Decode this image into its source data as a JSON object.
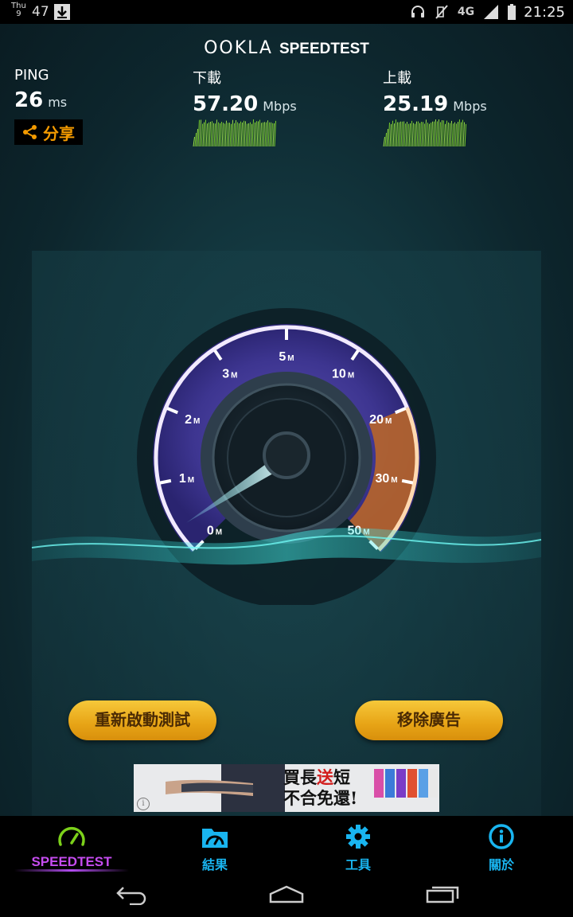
{
  "status_bar": {
    "day": "Thu",
    "date": "9",
    "notification_count": "47",
    "network": "4G",
    "time": "21:25"
  },
  "header": {
    "logo_part1": "OOKLA",
    "logo_part2": "SPEEDTEST"
  },
  "metrics": {
    "ping": {
      "label": "PING",
      "value": "26",
      "unit": "ms"
    },
    "download": {
      "label": "下載",
      "value": "57.20",
      "unit": "Mbps"
    },
    "upload": {
      "label": "上載",
      "value": "25.19",
      "unit": "Mbps"
    }
  },
  "share_label": "分享",
  "gauge": {
    "ticks": [
      {
        "num": "0",
        "unit": "M"
      },
      {
        "num": "1",
        "unit": "M"
      },
      {
        "num": "2",
        "unit": "M"
      },
      {
        "num": "3",
        "unit": "M"
      },
      {
        "num": "5",
        "unit": "M"
      },
      {
        "num": "10",
        "unit": "M"
      },
      {
        "num": "20",
        "unit": "M"
      },
      {
        "num": "30",
        "unit": "M"
      },
      {
        "num": "50",
        "unit": "M"
      }
    ],
    "needle_value": 0
  },
  "buttons": {
    "restart": "重新啟動測試",
    "remove_ads": "移除廣告"
  },
  "ad": {
    "line1_a": "買長",
    "line1_red": "送",
    "line1_b": "短",
    "line2": "不合免還!",
    "info": "i"
  },
  "nav": [
    {
      "label": "SPEEDTEST",
      "icon": "speedometer-icon",
      "active": true
    },
    {
      "label": "結果",
      "icon": "results-folder-icon",
      "active": false
    },
    {
      "label": "工具",
      "icon": "gear-icon",
      "active": false
    },
    {
      "label": "關於",
      "icon": "info-icon",
      "active": false
    }
  ],
  "colors": {
    "accent_orange": "#f39a00",
    "nav_blue": "#19b5f0",
    "nav_active": "#c64cf0",
    "button_gold": "#e7a416"
  }
}
